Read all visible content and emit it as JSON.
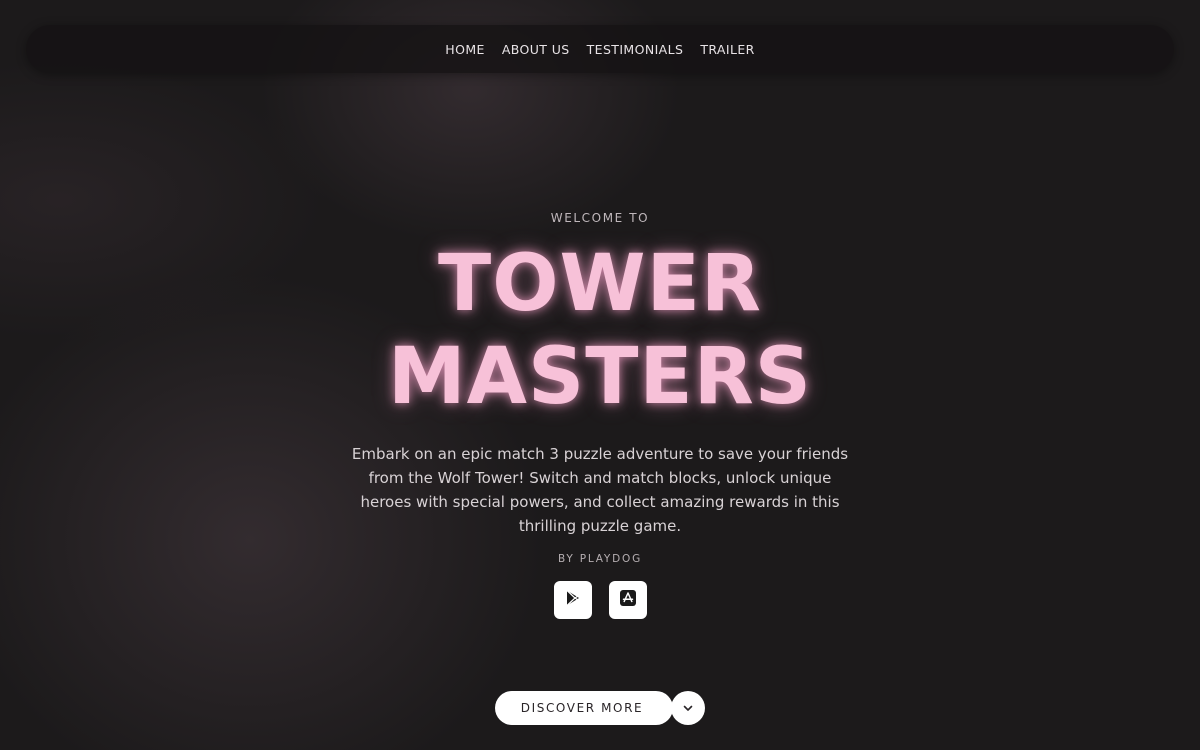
{
  "nav": {
    "items": [
      {
        "label": "HOME"
      },
      {
        "label": "ABOUT US"
      },
      {
        "label": "TESTIMONIALS"
      },
      {
        "label": "TRAILER"
      }
    ]
  },
  "hero": {
    "welcome": "WELCOME TO",
    "title_line1": "TOWER",
    "title_line2": "MASTERS",
    "description": "Embark on an epic match 3 puzzle adventure to save your friends from the Wolf Tower! Switch and match blocks, unlock unique heroes with special powers, and collect amazing rewards in this thrilling puzzle game.",
    "byline": "BY PLAYDOG",
    "stores": [
      {
        "icon": "google-play-icon"
      },
      {
        "icon": "app-store-icon"
      }
    ],
    "cta_label": "DISCOVER MORE",
    "cta_icon": "chevron-down-icon"
  },
  "colors": {
    "background": "#1c1a1b",
    "title_pink": "#f7c1d8",
    "button_white": "#ffffff"
  }
}
